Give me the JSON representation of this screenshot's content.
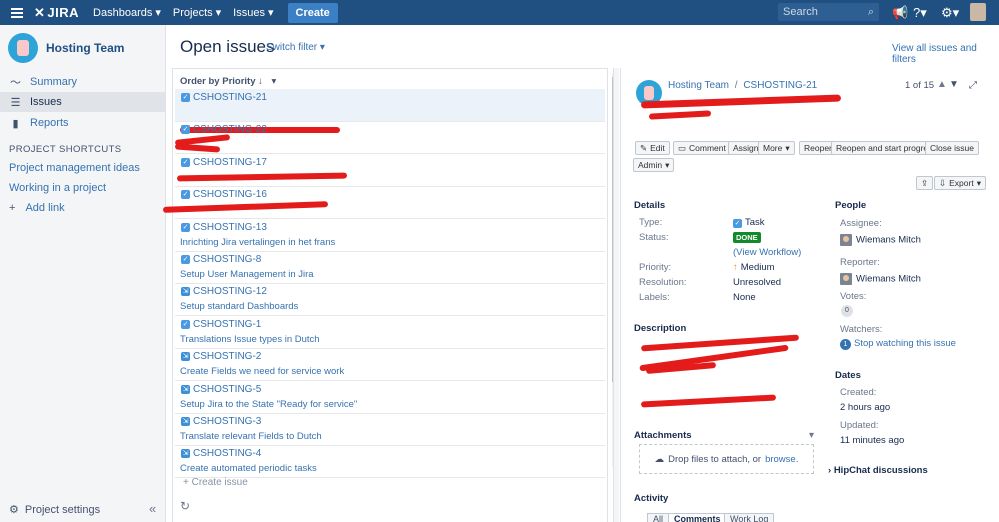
{
  "topbar": {
    "logo": "JIRA",
    "nav": [
      "Dashboards",
      "Projects",
      "Issues"
    ],
    "create": "Create",
    "search_placeholder": "Search"
  },
  "sidebar": {
    "project_name": "Hosting Team",
    "items": [
      {
        "label": "Summary",
        "icon": "pulse-icon"
      },
      {
        "label": "Issues",
        "icon": "issues-icon"
      },
      {
        "label": "Reports",
        "icon": "reports-icon"
      }
    ],
    "shortcuts_heading": "PROJECT SHORTCUTS",
    "shortcuts": [
      "Project management ideas",
      "Working in a project"
    ],
    "add_link": "Add link",
    "project_settings": "Project settings"
  },
  "main": {
    "title": "Open issues",
    "switch_filter": "Switch filter",
    "view_all": "View all issues and filters",
    "order_by": "Order by Priority"
  },
  "issues": [
    {
      "key": "CSHOSTING-21",
      "summary": "",
      "type": "task",
      "selected": true
    },
    {
      "key": "CSHOSTING-22",
      "summary": "",
      "type": "task"
    },
    {
      "key": "CSHOSTING-17",
      "summary": "",
      "type": "task"
    },
    {
      "key": "CSHOSTING-16",
      "summary": "",
      "type": "task"
    },
    {
      "key": "CSHOSTING-13",
      "summary": "Inrichting Jira vertalingen in het frans",
      "type": "task"
    },
    {
      "key": "CSHOSTING-8",
      "summary": "Setup User Management in Jira",
      "type": "task"
    },
    {
      "key": "CSHOSTING-12",
      "summary": "Setup standard Dashboards",
      "type": "subtask"
    },
    {
      "key": "CSHOSTING-1",
      "summary": "Translations Issue types in Dutch",
      "type": "task"
    },
    {
      "key": "CSHOSTING-2",
      "summary": "Create Fields we need for service work",
      "type": "subtask"
    },
    {
      "key": "CSHOSTING-5",
      "summary": "Setup Jira to the State \"Ready for service\"",
      "type": "subtask"
    },
    {
      "key": "CSHOSTING-3",
      "summary": "Translate relevant Fields to Dutch",
      "type": "subtask"
    },
    {
      "key": "CSHOSTING-4",
      "summary": "Create automated periodic tasks",
      "type": "subtask"
    }
  ],
  "create_issue": "+ Create issue",
  "detail": {
    "breadcrumb_project": "Hosting Team",
    "breadcrumb_sep": "/",
    "breadcrumb_key": "CSHOSTING-21",
    "pager": "1 of 15",
    "buttons": {
      "edit": "Edit",
      "comment": "Comment",
      "assign": "Assign",
      "more": "More",
      "reopen": "Reopen",
      "reopen_progress": "Reopen and start progress",
      "close": "Close issue",
      "admin": "Admin",
      "export": "Export"
    },
    "details_heading": "Details",
    "fields": {
      "type_label": "Type:",
      "type_value": "Task",
      "status_label": "Status:",
      "status_value": "DONE",
      "view_workflow": "(View Workflow)",
      "priority_label": "Priority:",
      "priority_value": "Medium",
      "resolution_label": "Resolution:",
      "resolution_value": "Unresolved",
      "labels_label": "Labels:",
      "labels_value": "None"
    },
    "description_heading": "Description",
    "attachments_heading": "Attachments",
    "drop_text": "Drop files to attach, or",
    "browse": "browse.",
    "activity_heading": "Activity",
    "activity_tabs": [
      "All",
      "Comments",
      "Work Log"
    ],
    "people_heading": "People",
    "assignee_label": "Assignee:",
    "assignee": "Wiemans Mitch",
    "reporter_label": "Reporter:",
    "reporter": "Wiemans Mitch",
    "votes_label": "Votes:",
    "votes": "0",
    "watchers_label": "Watchers:",
    "watchers_count": "1",
    "stop_watching": "Stop watching this issue",
    "dates_heading": "Dates",
    "created_label": "Created:",
    "created": "2 hours ago",
    "updated_label": "Updated:",
    "updated": "11 minutes ago",
    "hipchat": "HipChat discussions"
  },
  "colors": {
    "topbar": "#205081",
    "link": "#3572b0",
    "done": "#14892c",
    "redaction": "#e41b1b"
  }
}
